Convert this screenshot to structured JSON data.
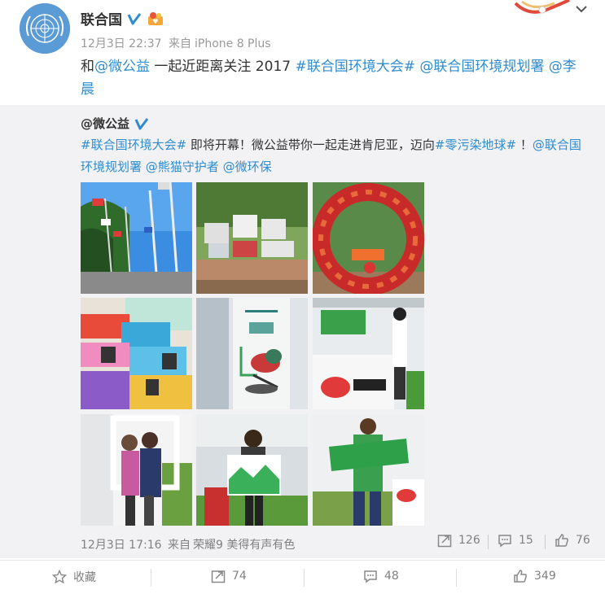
{
  "post": {
    "author": "联合国",
    "time": "12月3日 22:37",
    "source_prefix": "来自",
    "source": "iPhone 8 Plus",
    "text_parts": [
      {
        "t": "和",
        "link": false
      },
      {
        "t": "@微公益",
        "link": true
      },
      {
        "t": " 一起近距离关注 2017 ",
        "link": false
      },
      {
        "t": "#联合国环境大会#",
        "link": true
      },
      {
        "t": " ",
        "link": false
      },
      {
        "t": "@联合国环境规划署",
        "link": true
      },
      {
        "t": " ",
        "link": false
      },
      {
        "t": "@李晨",
        "link": true
      }
    ]
  },
  "repost": {
    "author": "@微公益",
    "text_parts": [
      {
        "t": "#联合国环境大会#",
        "link": true
      },
      {
        "t": " 即将开幕！微公益带你一起走进肯尼亚，迈向",
        "link": false
      },
      {
        "t": "#零污染地球#",
        "link": true
      },
      {
        "t": " ！",
        "link": false
      },
      {
        "t": "@联合国环境规划署",
        "link": true
      },
      {
        "t": " ",
        "link": false
      },
      {
        "t": "@熊猫守护者",
        "link": true
      },
      {
        "t": " ",
        "link": false
      },
      {
        "t": "@微环保",
        "link": true
      }
    ],
    "photos": [
      "flags-photo",
      "beat-pollution-sign-photo",
      "red-sculpture-photo",
      "colorful-cards-photo",
      "bird-poster-photo",
      "weibo-booth-photo",
      "two-women-frame-photo",
      "man-frame-photo",
      "man-green-sign-photo"
    ],
    "time": "12月3日 17:16",
    "source_prefix": "来自",
    "source": "荣耀9 美得有声有色",
    "forward_count": "126",
    "comment_count": "15",
    "like_count": "76"
  },
  "actions": {
    "favorite_label": "收藏",
    "forward_count": "74",
    "comment_count": "48",
    "like_count": "349"
  },
  "colors": {
    "link": "#2e8ccf",
    "repost_bg": "#f2f2f5",
    "verified": "#2e8ccf"
  }
}
